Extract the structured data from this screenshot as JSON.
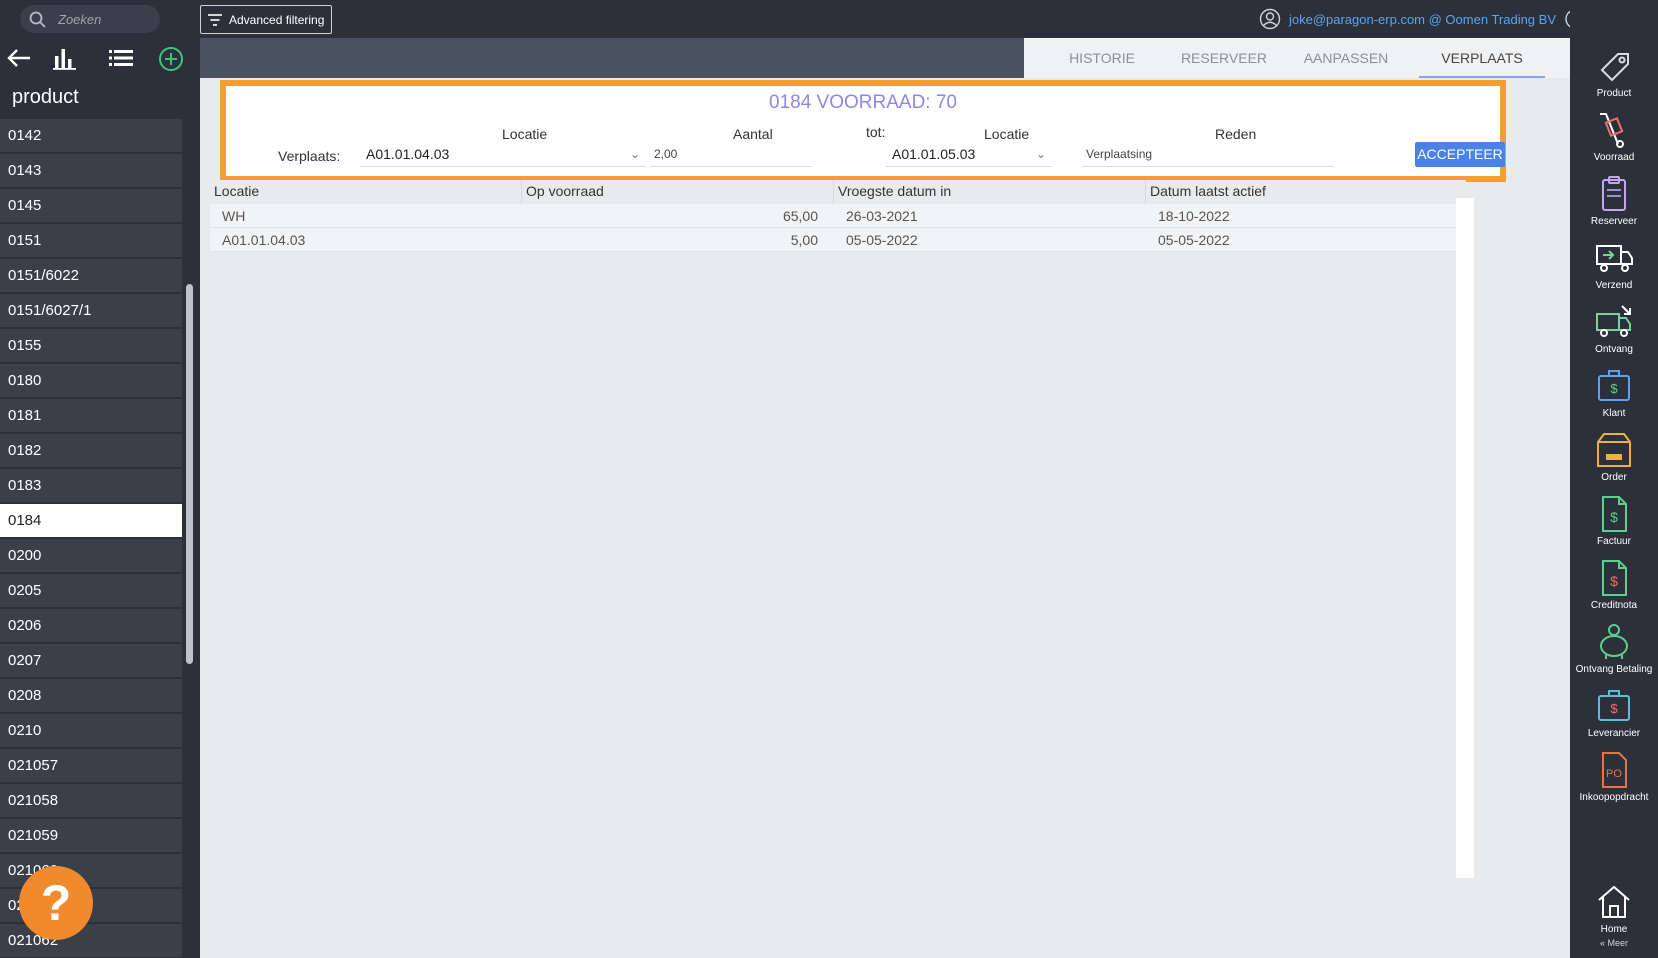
{
  "topbar": {
    "search_placeholder": "Zoeken",
    "advanced_filter_label": "Advanced filtering",
    "user_text": "joke@paragon-erp.com @ Oomen Trading BV"
  },
  "left": {
    "title": "product",
    "items": [
      "0142",
      "0143",
      "0145",
      "0151",
      "0151/6022",
      "0151/6027/1",
      "0155",
      "0180",
      "0181",
      "0182",
      "0183",
      "0184",
      "0200",
      "0205",
      "0206",
      "0207",
      "0208",
      "0210",
      "021057",
      "021058",
      "021059",
      "021060",
      "021061",
      "021062"
    ],
    "active_item": "0184"
  },
  "tabs": [
    {
      "label": "HISTORIE"
    },
    {
      "label": "RESERVEER"
    },
    {
      "label": "AANPASSEN"
    },
    {
      "label": "VERPLAATS"
    }
  ],
  "move": {
    "title": "0184 VOORRAAD: 70",
    "locatie_label": "Locatie",
    "aantal_label": "Aantal",
    "tot_label": "tot:",
    "locatie2_label": "Locatie",
    "reden_label": "Reden",
    "verplaats_label": "Verplaats:",
    "from_location": "A01.01.04.03",
    "amount": "2,00",
    "to_location": "A01.01.05.03",
    "reason": "Verplaatsing",
    "accept_label": "ACCEPTEER"
  },
  "table": {
    "headers": [
      "Locatie",
      "Op voorraad",
      "Vroegste datum in",
      "Datum laatst actief"
    ],
    "rows": [
      {
        "locatie": "WH",
        "voorraad": "65,00",
        "vroegste": "26-03-2021",
        "laatst": "18-10-2022"
      },
      {
        "locatie": "A01.01.04.03",
        "voorraad": "5,00",
        "vroegste": "05-05-2022",
        "laatst": "05-05-2022"
      }
    ]
  },
  "right_bar": [
    {
      "label": "Product",
      "icon": "tag-icon",
      "color": "#d9dce0"
    },
    {
      "label": "Voorraad",
      "icon": "hand-truck-icon",
      "color": "#f07060"
    },
    {
      "label": "Reserveer",
      "icon": "clipboard-icon",
      "color": "#c0a8f0"
    },
    {
      "label": "Verzend",
      "icon": "send-truck-icon",
      "color": "#ffffff"
    },
    {
      "label": "Ontvang",
      "icon": "receive-truck-icon",
      "color": "#7ad29a"
    },
    {
      "label": "Klant",
      "icon": "customer-icon",
      "color": "#5aa4f0"
    },
    {
      "label": "Order",
      "icon": "order-box-icon",
      "color": "#f0b040"
    },
    {
      "label": "Factuur",
      "icon": "invoice-icon",
      "color": "#5cd08a"
    },
    {
      "label": "Creditnota",
      "icon": "credit-note-icon",
      "color": "#5cd08a"
    },
    {
      "label": "Ontvang Betaling",
      "icon": "piggy-bank-icon",
      "color": "#5cd08a"
    },
    {
      "label": "Leverancier",
      "icon": "supplier-icon",
      "color": "#5ac0d8"
    },
    {
      "label": "Inkoopopdracht",
      "icon": "purchase-order-icon",
      "color": "#f07040"
    }
  ],
  "home_label": "Home",
  "more_label": "« Meer"
}
